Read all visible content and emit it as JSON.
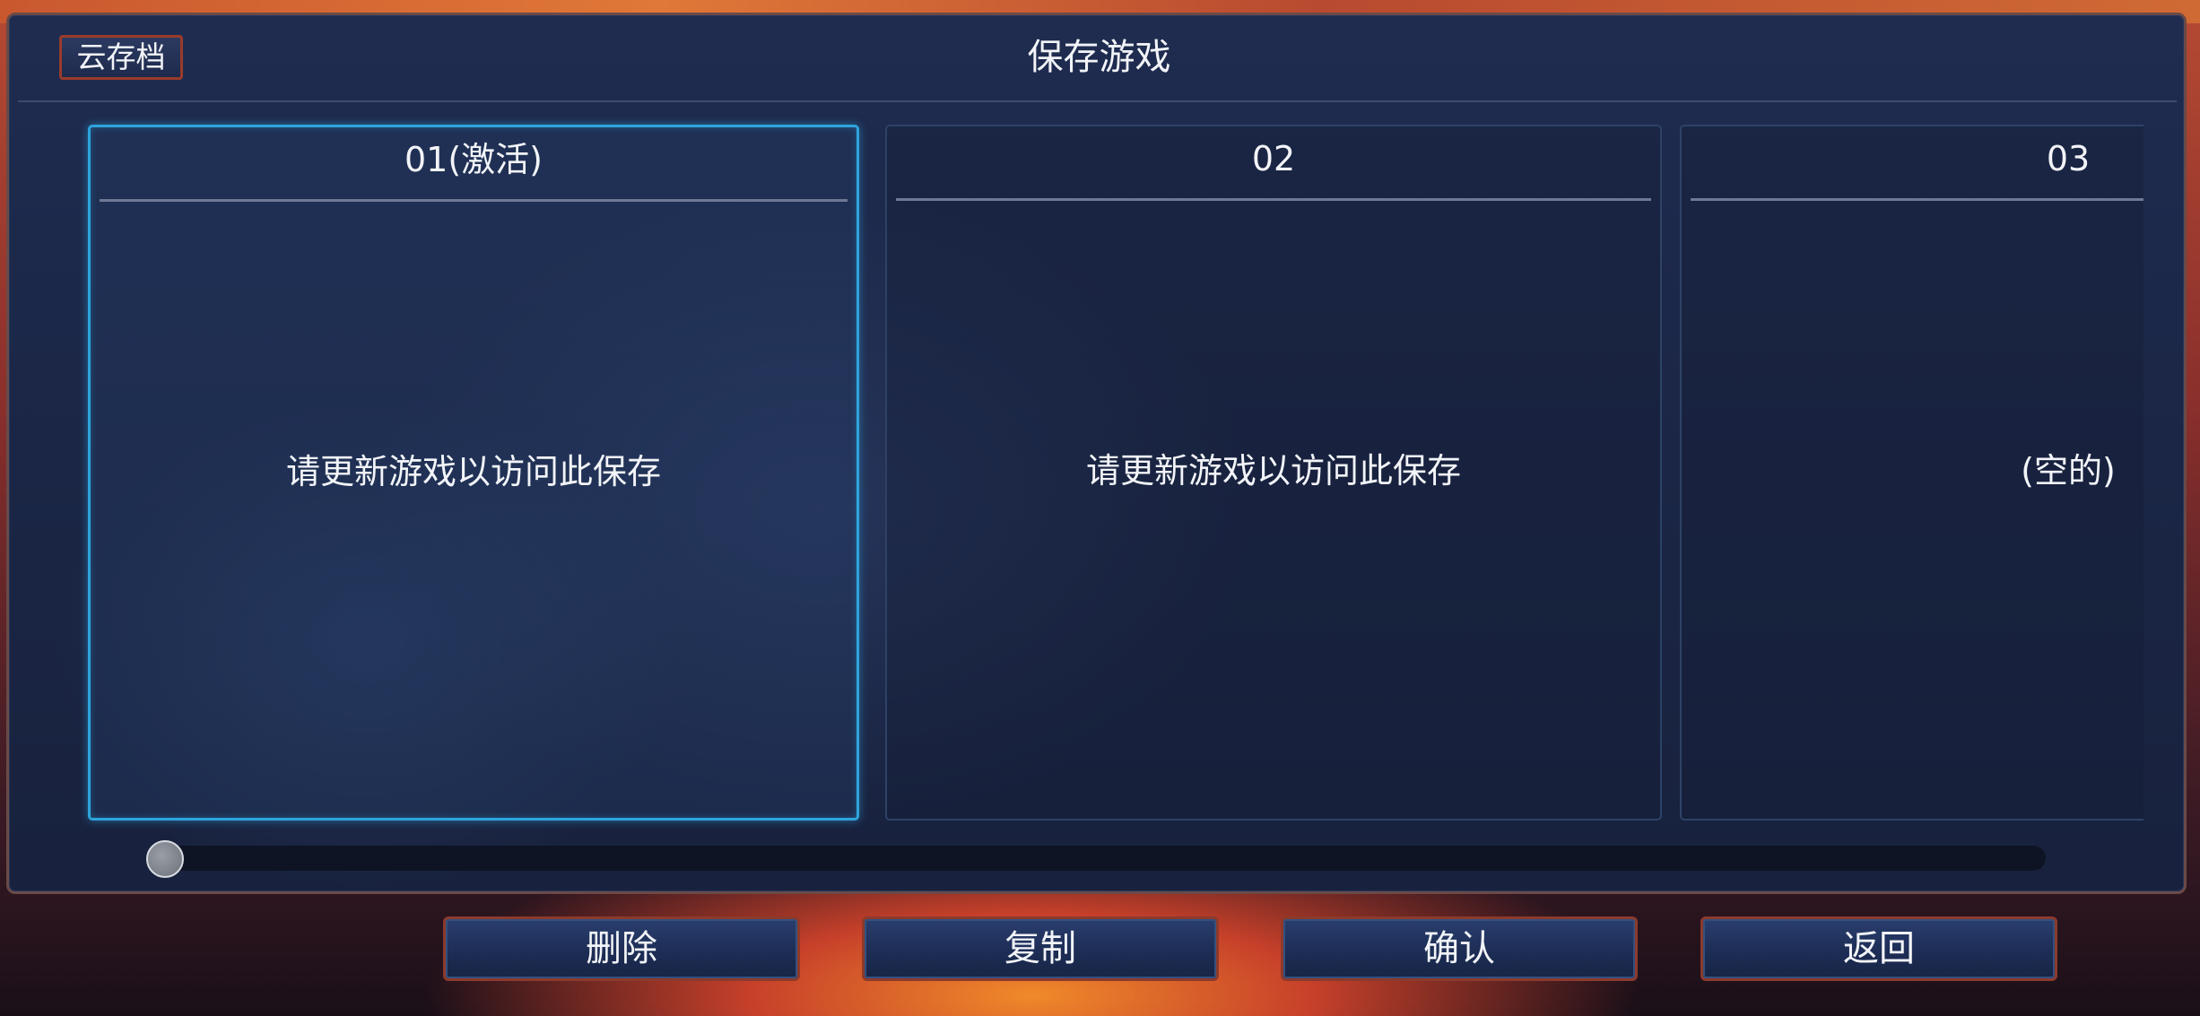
{
  "header": {
    "title": "保存游戏",
    "cloud_label": "云存档"
  },
  "slots": [
    {
      "title": "01(激活)",
      "message": "请更新游戏以访问此保存",
      "active": true
    },
    {
      "title": "02",
      "message": "请更新游戏以访问此保存",
      "active": false
    },
    {
      "title": "03",
      "message": "(空的)",
      "active": false
    }
  ],
  "scrollbar": {
    "position": 0
  },
  "actions": {
    "delete_label": "删除",
    "copy_label": "复制",
    "confirm_label": "确认",
    "back_label": "返回"
  },
  "colors": {
    "active_border": "#2ea4dc",
    "button_border": "#8c3a2c",
    "panel_bg": "#1f2c50"
  }
}
